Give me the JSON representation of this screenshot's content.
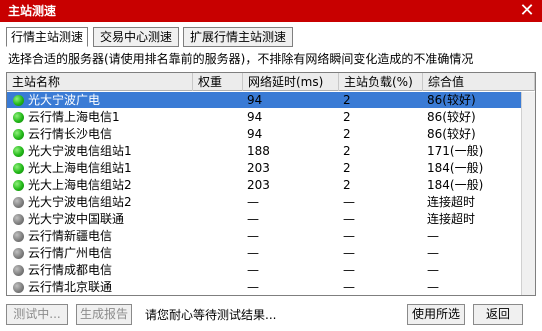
{
  "window": {
    "title": "主站测速",
    "close_label": "✕"
  },
  "tabs": [
    {
      "label": "行情主站测速",
      "active": true
    },
    {
      "label": "交易中心测速",
      "active": false
    },
    {
      "label": "扩展行情主站测速",
      "active": false
    }
  ],
  "hint": "选择合适的服务器(请使用排名靠前的服务器)，不排除有网络瞬间变化造成的不准确情况",
  "table": {
    "columns": [
      "主站名称",
      "权重",
      "网络延时(ms)",
      "主站负载(%)",
      "综合值"
    ],
    "rows": [
      {
        "status": "green",
        "name": "光大宁波广电",
        "weight": "",
        "latency": "94",
        "load": "2",
        "score": "86(较好)",
        "selected": true
      },
      {
        "status": "green",
        "name": "云行情上海电信1",
        "weight": "",
        "latency": "94",
        "load": "2",
        "score": "86(较好)",
        "selected": false
      },
      {
        "status": "green",
        "name": "云行情长沙电信",
        "weight": "",
        "latency": "94",
        "load": "2",
        "score": "86(较好)",
        "selected": false
      },
      {
        "status": "green",
        "name": "光大宁波电信组站1",
        "weight": "",
        "latency": "188",
        "load": "2",
        "score": "171(一般)",
        "selected": false
      },
      {
        "status": "green",
        "name": "光大上海电信组站1",
        "weight": "",
        "latency": "203",
        "load": "2",
        "score": "184(一般)",
        "selected": false
      },
      {
        "status": "green",
        "name": "光大上海电信组站2",
        "weight": "",
        "latency": "203",
        "load": "2",
        "score": "184(一般)",
        "selected": false
      },
      {
        "status": "gray",
        "name": "光大宁波电信组站2",
        "weight": "",
        "latency": "—",
        "load": "—",
        "score": "连接超时",
        "selected": false
      },
      {
        "status": "gray",
        "name": "光大宁波中国联通",
        "weight": "",
        "latency": "—",
        "load": "—",
        "score": "连接超时",
        "selected": false
      },
      {
        "status": "gray",
        "name": "云行情新疆电信",
        "weight": "",
        "latency": "—",
        "load": "—",
        "score": "—",
        "selected": false
      },
      {
        "status": "gray",
        "name": "云行情广州电信",
        "weight": "",
        "latency": "—",
        "load": "—",
        "score": "—",
        "selected": false
      },
      {
        "status": "gray",
        "name": "云行情成都电信",
        "weight": "",
        "latency": "—",
        "load": "—",
        "score": "—",
        "selected": false
      },
      {
        "status": "gray",
        "name": "云行情北京联通",
        "weight": "",
        "latency": "—",
        "load": "—",
        "score": "—",
        "selected": false
      }
    ]
  },
  "footer": {
    "testing_label": "测试中...",
    "report_label": "生成报告",
    "wait_text": "请您耐心等待测试结果...",
    "use_selected_label": "使用所选",
    "back_label": "返回"
  },
  "colors": {
    "title_bar": "#c80000",
    "selection": "#3a7bd5",
    "status_green": "#22b818",
    "status_gray": "#7a7a7a"
  }
}
